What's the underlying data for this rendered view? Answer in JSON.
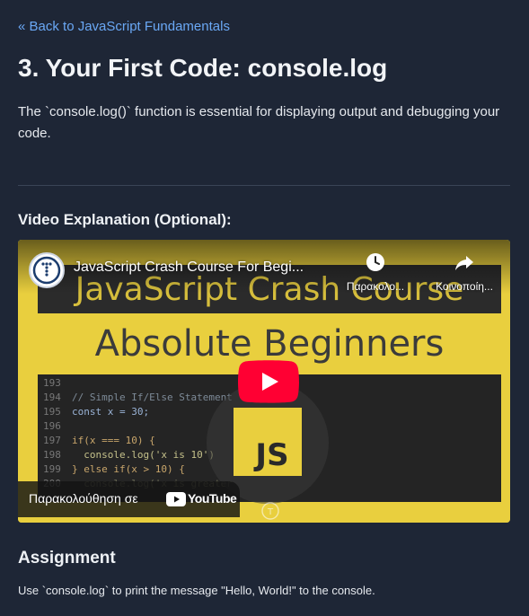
{
  "nav": {
    "back_label": "« Back to JavaScript Fundamentals"
  },
  "lesson": {
    "title": "3. Your First Code: console.log",
    "intro": "The `console.log()` function is essential for displaying output and debugging your code."
  },
  "video_section": {
    "heading": "Video Explanation (Optional):",
    "video_title": "JavaScript Crash Course For Begi...",
    "watch_later_label": "Παρακολο...",
    "share_label": "Κοινοποίη...",
    "watch_on_label": "Παρακολούθηση σε",
    "youtube_label": "YouTube",
    "thumbnail": {
      "heading_line1": "JavaScript Crash Course",
      "heading_line2": "Absolute Beginners",
      "badge_text": "JS",
      "code_lines": [
        {
          "num": "193",
          "code": ""
        },
        {
          "num": "194",
          "code": "// Simple If/Else Statement"
        },
        {
          "num": "195",
          "code": "const x = 30;"
        },
        {
          "num": "196",
          "code": ""
        },
        {
          "num": "197",
          "code": "if(x === 10) {"
        },
        {
          "num": "198",
          "code": "  console.log('x is 10')"
        },
        {
          "num": "199",
          "code": "} else if(x > 10) {"
        },
        {
          "num": "200",
          "code": "  console.log('x is greater"
        }
      ]
    },
    "icons": [
      "channel-avatar-icon",
      "clock-icon",
      "share-icon",
      "play-icon",
      "youtube-logo-icon",
      "watermark-icon"
    ]
  },
  "assignment": {
    "heading": "Assignment",
    "text": "Use `console.log` to print the message \"Hello, World!\" to the console."
  },
  "colors": {
    "background": "#1e2636",
    "link": "#6aa8f5",
    "thumbnail_yellow": "#e9cf3e",
    "youtube_red": "#ff0033"
  }
}
